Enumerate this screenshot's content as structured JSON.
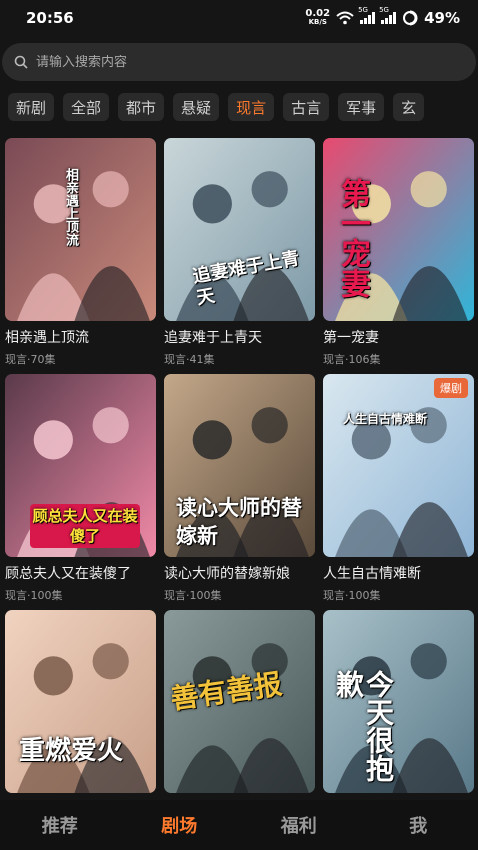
{
  "status": {
    "time": "20:56",
    "net_speed": "0.02",
    "net_unit": "KB/S",
    "sim1": "5G",
    "sim2": "5G",
    "battery": "49%"
  },
  "search": {
    "placeholder": "请输入搜索内容"
  },
  "categories": [
    "新剧",
    "全部",
    "都市",
    "悬疑",
    "现言",
    "古言",
    "军事",
    "玄"
  ],
  "active_category": "现言",
  "dramas": [
    {
      "title": "相亲遇上顶流",
      "meta": "现言·70集",
      "poster_text": "相亲遇上顶流",
      "colors": [
        "#c98a7a",
        "#7a4a55",
        "#e9b7b7"
      ]
    },
    {
      "title": "追妻难于上青天",
      "meta": "现言·41集",
      "poster_text": "追妻难于上青天",
      "colors": [
        "#7e9aa8",
        "#c9d6d9",
        "#3d4f5c"
      ]
    },
    {
      "title": "第一宠妻",
      "meta": "现言·106集",
      "poster_text": "第一宠妻",
      "colors": [
        "#2fb6d9",
        "#e84a6f",
        "#f3e3a3"
      ]
    },
    {
      "title": "顾总夫人又在装傻了",
      "meta": "现言·100集",
      "poster_text": "顾总夫人又在装傻了",
      "colors": [
        "#f08aa8",
        "#5a3a4a",
        "#f6c7d1"
      ]
    },
    {
      "title": "读心大师的替嫁新娘",
      "meta": "现言·100集",
      "poster_text": "读心大师的替嫁新",
      "colors": [
        "#5a4a3a",
        "#c4a88a",
        "#2a2a2a"
      ]
    },
    {
      "title": "人生自古情难断",
      "meta": "现言·100集",
      "poster_text": "人生自古情难断",
      "badge": "爆剧",
      "colors": [
        "#8fb5d6",
        "#d9e7ef",
        "#5a6c7c"
      ]
    },
    {
      "title": "",
      "meta": "",
      "poster_text": "重燃爱火",
      "colors": [
        "#c9a08a",
        "#f0d3c0",
        "#7a5a4a"
      ]
    },
    {
      "title": "",
      "meta": "",
      "poster_text": "善有善报",
      "colors": [
        "#4a5a5a",
        "#8a9a9a",
        "#2a3030"
      ]
    },
    {
      "title": "",
      "meta": "",
      "poster_text": "今天很抱歉",
      "colors": [
        "#5a7a8a",
        "#a8c0c8",
        "#2a3a44"
      ]
    }
  ],
  "nav": [
    {
      "label": "推荐",
      "active": false
    },
    {
      "label": "剧场",
      "active": true
    },
    {
      "label": "福利",
      "active": false
    },
    {
      "label": "我",
      "active": false
    }
  ],
  "accent_color": "#ff7a2d"
}
